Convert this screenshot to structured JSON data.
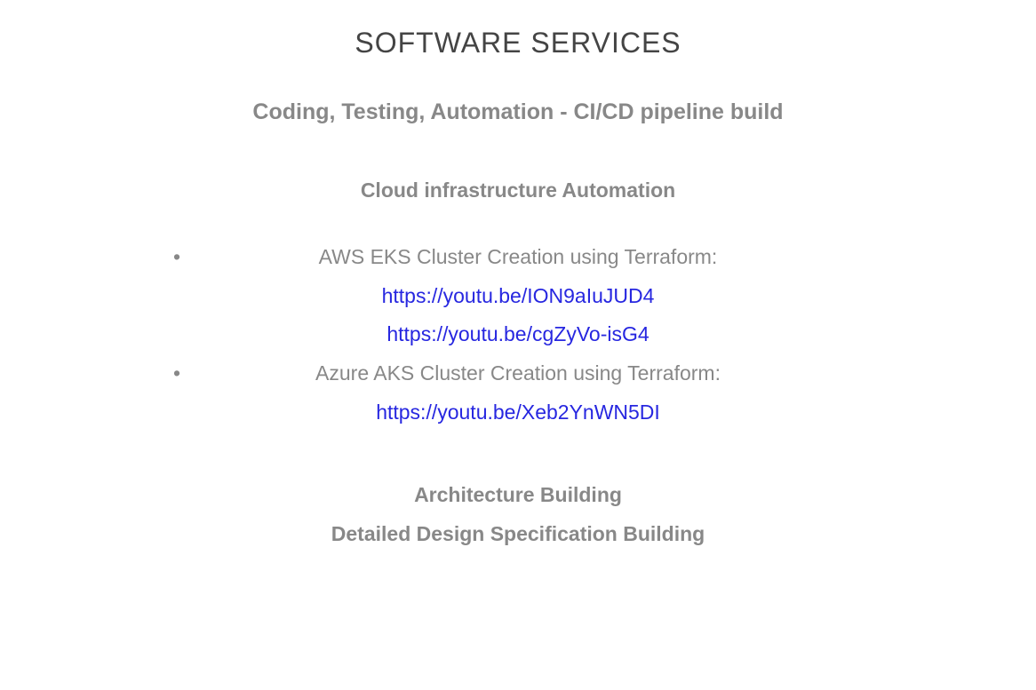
{
  "title": "SOFTWARE SERVICES",
  "subtitle": "Coding, Testing, Automation - CI/CD pipeline build",
  "section1": {
    "heading": "Cloud infrastructure Automation",
    "items": [
      {
        "label": "AWS EKS Cluster Creation using Terraform:",
        "links": [
          "https://youtu.be/ION9aIuJUD4",
          "https://youtu.be/cgZyVo-isG4"
        ]
      },
      {
        "label": "Azure AKS Cluster Creation using Terraform:",
        "links": [
          "https://youtu.be/Xeb2YnWN5DI"
        ]
      }
    ]
  },
  "bottom": {
    "heading1": "Architecture Building",
    "heading2": "Detailed Design Specification Building"
  }
}
